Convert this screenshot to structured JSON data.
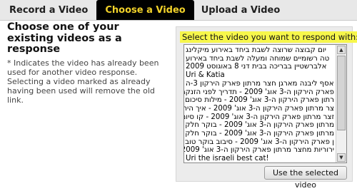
{
  "tabs": [
    {
      "label": "Record a Video",
      "active": false
    },
    {
      "label": "Choose a Video",
      "active": true
    },
    {
      "label": "Upload a Video",
      "active": false
    }
  ],
  "left": {
    "heading": "Choose one of your existing videos as a response",
    "note": "* Indicates the video has already been used for another video response. Selecting a video marked as already having been used will remove the old link."
  },
  "panel": {
    "title": "Select the video you want to respond with:",
    "options": [
      "יום קבוצה שרוצה לשבת ביחד באירוע מיקלינג",
      "טה רשומיים שמוחה ומעלה לשבת ביחד באירוע",
      "אלברשטיין בבריכה בבית דני 8 באוגוסט 2009",
      "Uri & Katia",
      "אסף ליבנה מארגן חצר מרתון פארק הירקון 3-ה",
      "פארק הירקון ה-3 אוג' 2009 - תדריך לפני הזנקה",
      "רתון פארק הירקון ה-3 אוג' 2009 - מילות סיכום",
      "צר מרתון פארק הירקון ה-3 אוג' 2009 - איך היה",
      "זצר מרתון פארק הירקון ה-3 אוג' 2009 - קו סיום",
      "מרתון פארק הירקון ה-3 אוג' 2009 - בוקר חלק א",
      "מרתון פארק הירקון ה-3 אוג' 2009 - בוקר חלק ב",
      "ן פארק הירקון ה-3 אוג' 2009 - סיבוב בוקר טוב",
      "ירוריות מחצר מרתון פארק הירקון ה-3 אוג' 2009",
      "Uri the israeli best cat!"
    ],
    "button_label": "Use the selected video"
  },
  "colors": {
    "active_tab_bg": "#000000",
    "active_tab_text": "#f2d22a",
    "title_highlight": "#f7f74b"
  }
}
